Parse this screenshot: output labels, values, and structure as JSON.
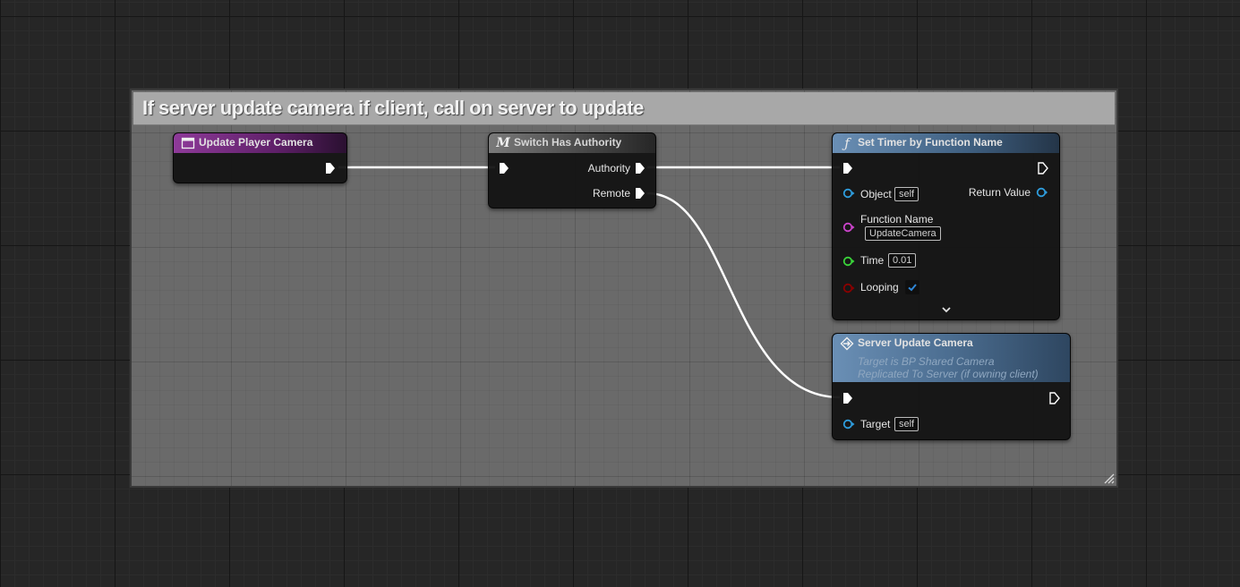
{
  "comment": {
    "title": "If server update camera if client, call on server to update"
  },
  "nodes": {
    "update_player_camera": {
      "title": "Update Player Camera"
    },
    "switch_has_authority": {
      "title": "Switch Has Authority",
      "pins": {
        "authority": "Authority",
        "remote": "Remote"
      }
    },
    "set_timer": {
      "title": "Set Timer by Function Name",
      "pins": {
        "object": "Object",
        "object_default": "self",
        "return_value": "Return Value",
        "function_name": "Function Name",
        "function_name_value": "UpdateCamera",
        "time": "Time",
        "time_value": "0.01",
        "looping": "Looping"
      },
      "looping_checked": true
    },
    "server_update_camera": {
      "title": "Server Update Camera",
      "subtitle_1": "Target is BP Shared Camera",
      "subtitle_2": "Replicated To Server (if owning client)",
      "pins": {
        "target": "Target",
        "target_default": "self"
      }
    }
  },
  "icons": {
    "event": "event-icon",
    "macro": "macro-icon",
    "function": "function-icon",
    "rpc": "rpc-icon"
  },
  "colors": {
    "event_header": "#7b2c86",
    "macro_header": "#5a5a5a",
    "function_header": "#4d6b8a",
    "object_pin": "#2e9cdc",
    "name_pin": "#cc44cc",
    "float_pin": "#3ad43a",
    "bool_pin": "#8a0000",
    "exec_wire": "#ffffff"
  }
}
